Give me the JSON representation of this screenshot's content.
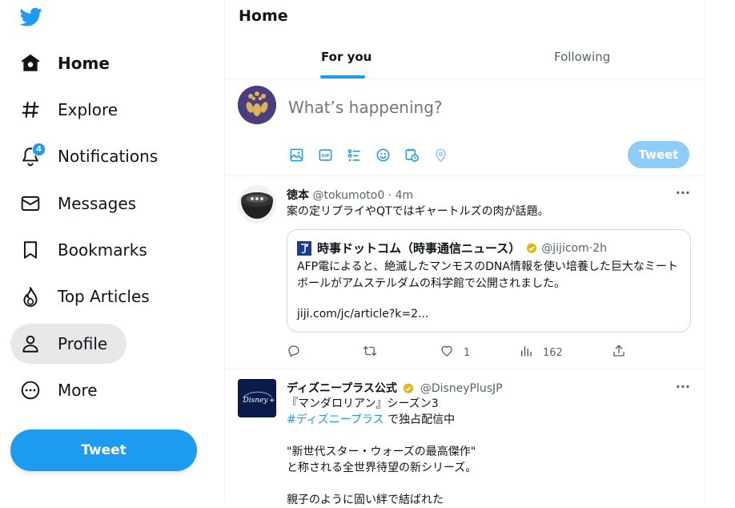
{
  "sidebar": {
    "items": [
      {
        "label": "Home",
        "icon": "home-icon",
        "active": true
      },
      {
        "label": "Explore",
        "icon": "hashtag-icon"
      },
      {
        "label": "Notifications",
        "icon": "bell-icon",
        "badge": "4"
      },
      {
        "label": "Messages",
        "icon": "envelope-icon"
      },
      {
        "label": "Bookmarks",
        "icon": "bookmark-icon"
      },
      {
        "label": "Top Articles",
        "icon": "flame-icon"
      },
      {
        "label": "Profile",
        "icon": "person-icon",
        "hovered": true
      },
      {
        "label": "More",
        "icon": "more-circle-icon"
      }
    ],
    "tweet_label": "Tweet"
  },
  "header": {
    "title": "Home",
    "tabs": [
      {
        "label": "For you",
        "selected": true
      },
      {
        "label": "Following",
        "selected": false
      }
    ]
  },
  "compose": {
    "placeholder": "What’s happening?",
    "tweet_label": "Tweet",
    "tools": [
      "image-icon",
      "gif-icon",
      "poll-icon",
      "emoji-icon",
      "schedule-icon",
      "location-icon"
    ]
  },
  "posts": [
    {
      "name": "徳本",
      "handle": "@tokumoto0",
      "time": "4m",
      "text": "案の定リプライやQTではギャートルズの肉が話題。",
      "quote": {
        "name": "時事ドットコム（時事通信ニュース）",
        "handle": "@jijicom",
        "time": "2h",
        "text": "AFP電によると、絶滅したマンモスのDNA情報を使い培養した巨大なミートボールがアムステルダムの科学館で公開されました。",
        "link": "jiji.com/jc/article?k=2..."
      },
      "actions": {
        "reply": "",
        "retweet": "",
        "like": "1",
        "views": "162"
      }
    },
    {
      "name": "ディズニープラス公式",
      "handle": "@DisneyPlusJP",
      "lines": [
        "『マンダロリアン』シーズン3",
        "#ディズニープラス",
        "で独占配信中",
        "\"新世代スター・ウォーズの最高傑作\"",
        "と称される全世界待望の新シリーズ。",
        "親子のように固い絆で結ばれた"
      ]
    }
  ],
  "colors": {
    "accent": "#1d9bf0",
    "text": "#0f1419",
    "muted": "#536471",
    "verified": "#e2b719"
  }
}
